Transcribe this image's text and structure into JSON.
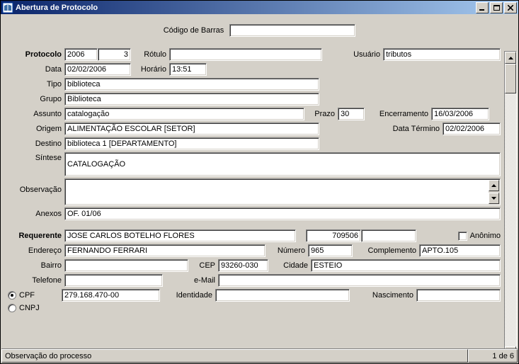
{
  "window": {
    "title": "Abertura de Protocolo"
  },
  "topbar": {
    "codigo_label": "Código de Barras",
    "codigo_value": ""
  },
  "form": {
    "protocolo_label": "Protocolo",
    "protocolo_year": "2006",
    "protocolo_num": "3",
    "rotulo_label": "Rótulo",
    "rotulo_value": "",
    "usuario_label": "Usuário",
    "usuario_value": "tributos",
    "data_label": "Data",
    "data_value": "02/02/2006",
    "horario_label": "Horário",
    "horario_value": "13:51",
    "tipo_label": "Tipo",
    "tipo_value": "biblioteca",
    "grupo_label": "Grupo",
    "grupo_value": "Biblioteca",
    "assunto_label": "Assunto",
    "assunto_value": "catalogação",
    "prazo_label": "Prazo",
    "prazo_value": "30",
    "encerramento_label": "Encerramento",
    "encerramento_value": "16/03/2006",
    "origem_label": "Origem",
    "origem_value": "ALIMENTAÇÃO ESCOLAR [SETOR]",
    "data_termino_label": "Data Término",
    "data_termino_value": "02/02/2006",
    "destino_label": "Destino",
    "destino_value": "biblioteca 1 [DEPARTAMENTO]",
    "sintese_label": "Síntese",
    "sintese_value": "CATALOGAÇÃO",
    "observacao_label": "Observação",
    "observacao_value": "",
    "anexos_label": "Anexos",
    "anexos_value": "OF. 01/06"
  },
  "req": {
    "requerente_label": "Requerente",
    "requerente_value": "JOSE  CARLOS BOTELHO FLORES",
    "requerente_code": "709506",
    "requerente_extra": "",
    "anonimo_label": "Anônimo",
    "endereco_label": "Endereço",
    "endereco_value": "FERNANDO FERRARI",
    "numero_label": "Número",
    "numero_value": "965",
    "complemento_label": "Complemento",
    "complemento_value": "APTO.105",
    "bairro_label": "Bairro",
    "bairro_value": "",
    "cep_label": "CEP",
    "cep_value": "93260-030",
    "cidade_label": "Cidade",
    "cidade_value": "ESTEIO",
    "telefone_label": "Telefone",
    "telefone_value": "",
    "email_label": "e-Mail",
    "email_value": "",
    "cpf_label": "CPF",
    "cpf_value": "279.168.470-00",
    "identidade_label": "Identidade",
    "identidade_value": "",
    "nascimento_label": "Nascimento",
    "nascimento_value": "",
    "cnpj_label": "CNPJ"
  },
  "status": {
    "left": "Observação do processo",
    "right": "1 de 6"
  }
}
